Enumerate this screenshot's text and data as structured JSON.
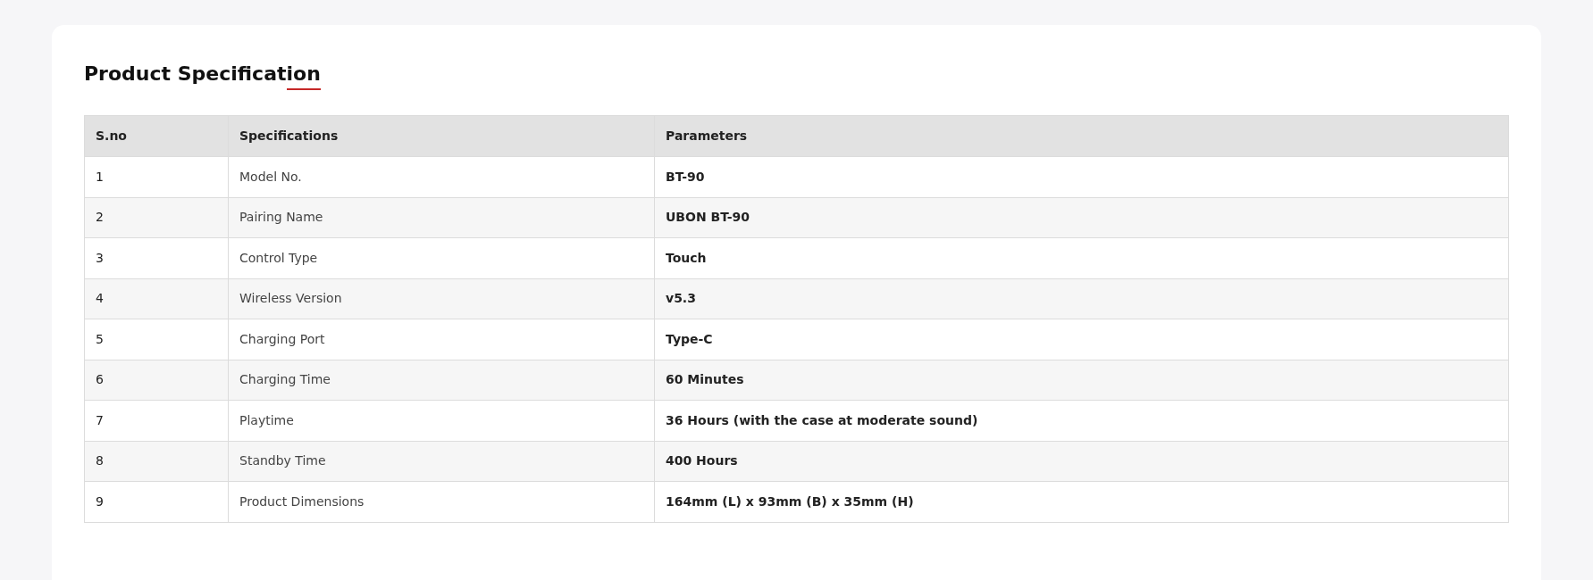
{
  "title": "Product Specification",
  "table": {
    "columns": [
      "S.no",
      "Specifications",
      "Parameters"
    ],
    "rows": [
      {
        "sno": "1",
        "specification": "Model No.",
        "parameter": "BT-90"
      },
      {
        "sno": "2",
        "specification": "Pairing Name",
        "parameter": "UBON BT-90"
      },
      {
        "sno": "3",
        "specification": "Control Type",
        "parameter": "Touch"
      },
      {
        "sno": "4",
        "specification": "Wireless Version",
        "parameter": "v5.3"
      },
      {
        "sno": "5",
        "specification": "Charging Port",
        "parameter": "Type-C"
      },
      {
        "sno": "6",
        "specification": "Charging Time",
        "parameter": "60 Minutes"
      },
      {
        "sno": "7",
        "specification": "Playtime",
        "parameter": "36 Hours (with the case at moderate sound)"
      },
      {
        "sno": "8",
        "specification": "Standby Time",
        "parameter": "400 Hours"
      },
      {
        "sno": "9",
        "specification": "Product Dimensions",
        "parameter": "164mm (L) x 93mm (B) x 35mm (H)"
      }
    ]
  }
}
